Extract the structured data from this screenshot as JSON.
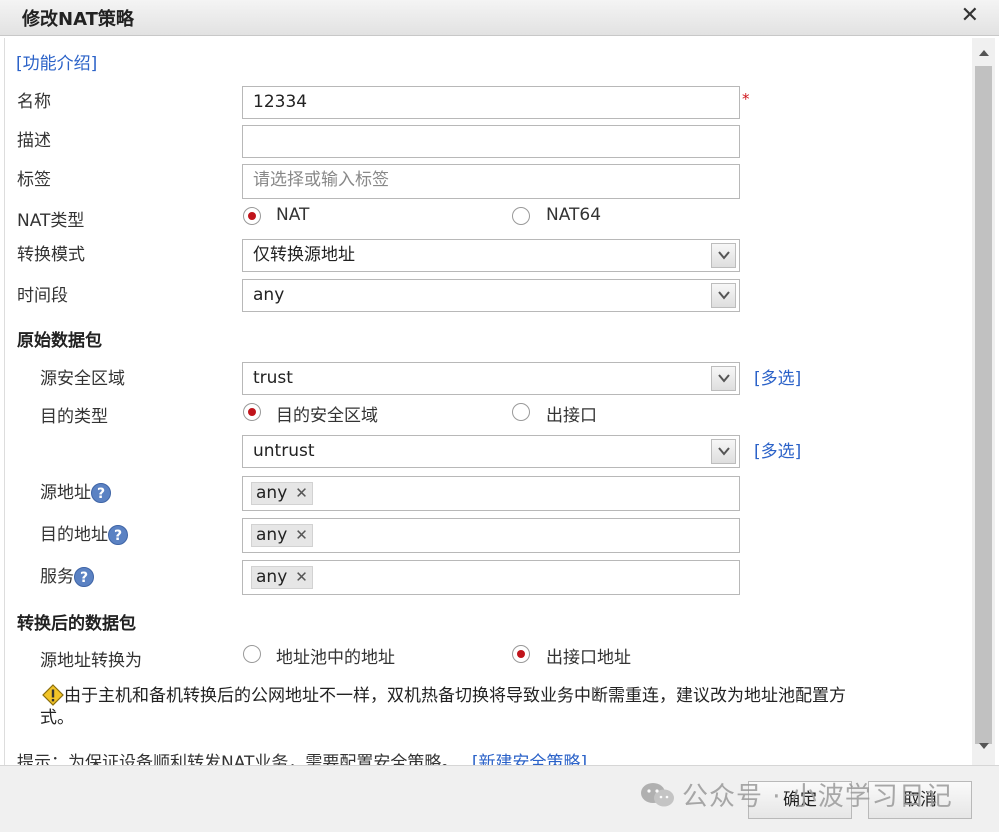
{
  "dialog": {
    "title": "修改NAT策略",
    "close_glyph": "✕"
  },
  "intro_link": "[功能介绍]",
  "fields": {
    "name_label": "名称",
    "name_value": "12334",
    "required_mark": "*",
    "desc_label": "描述",
    "desc_value": "",
    "tag_label": "标签",
    "tag_placeholder": "请选择或输入标签",
    "nat_type_label": "NAT类型",
    "nat_type_options": [
      "NAT",
      "NAT64"
    ],
    "nat_type_selected": "NAT",
    "mode_label": "转换模式",
    "mode_value": "仅转换源地址",
    "time_label": "时间段",
    "time_value": "any"
  },
  "original_packet": {
    "section_title": "原始数据包",
    "src_zone_label": "源安全区域",
    "src_zone_value": "trust",
    "multi_select": "[多选]",
    "dst_type_label": "目的类型",
    "dst_type_options": [
      "目的安全区域",
      "出接口"
    ],
    "dst_type_selected": "目的安全区域",
    "dst_zone_value": "untrust",
    "src_addr_label": "源地址",
    "src_addr_tag": "any",
    "dst_addr_label": "目的地址",
    "dst_addr_tag": "any",
    "service_label": "服务",
    "service_tag": "any",
    "help_glyph": "?",
    "remove_glyph": "✕"
  },
  "translated_packet": {
    "section_title": "转换后的数据包",
    "src_translate_label": "源地址转换为",
    "src_translate_options": [
      "地址池中的地址",
      "出接口地址"
    ],
    "src_translate_selected": "出接口地址",
    "warning_text": "由于主机和备机转换后的公网地址不一样，双机热备切换将导致业务中断需重连，建议改为地址池配置方式。"
  },
  "hint": {
    "text": "提示：为保证设备顺利转发NAT业务，需要配置安全策略。",
    "link": "[新建安全策略]"
  },
  "footer": {
    "ok_label": "确定",
    "cancel_label": "取消",
    "watermark": "公众号 · 小波学习日记"
  },
  "colors": {
    "accent_link": "#2b62c8",
    "radio_dot": "#c0141b",
    "required": "#d0161c"
  }
}
